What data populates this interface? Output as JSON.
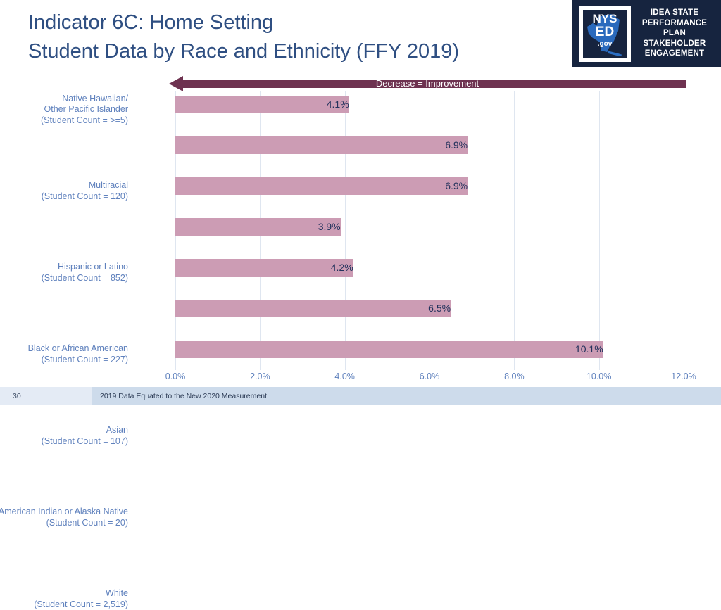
{
  "logo": {
    "badge_text": "NYS\nED\n.gov",
    "nys_line1": "NYS",
    "nys_line2": "ED",
    "nys_line3": ".gov",
    "caption": "IDEA STATE\nPERFORMANCE\nPLAN\nSTAKEHOLDER\nENGAGEMENT",
    "background_color": "#16243f"
  },
  "header": {
    "title": "Indicator 6C: Home Setting\nStudent Data by Race and Ethnicity (FFY 2019)",
    "title_color": "#2f4f82"
  },
  "banner": {
    "label": "Decrease = Improvement",
    "color": "#6e3250"
  },
  "footer": {
    "slide_number": "30",
    "note": "2019 Data Equated to the New 2020 Measurement"
  },
  "chart_data": {
    "type": "bar",
    "orientation": "horizontal",
    "title": "Indicator 6C: Home Setting Student Data by Race and Ethnicity (FFY 2019)",
    "xlabel": "",
    "ylabel": "",
    "xlim": [
      0,
      12
    ],
    "grid": true,
    "legend": "none",
    "bar_color": "#cc9cb4",
    "value_label_color": "#23325c",
    "category_label_color": "#5f81bd",
    "tick_labels": [
      "0.0%",
      "2.0%",
      "4.0%",
      "6.0%",
      "8.0%",
      "10.0%",
      "12.0%"
    ],
    "tick_values": [
      0,
      2,
      4,
      6,
      8,
      10,
      12
    ],
    "categories": [
      "Native Hawaiian/\nOther Pacific Islander\n(Student Count = >=5)",
      "Multiracial\n(Student Count = 120)",
      "Hispanic or Latino\n(Student Count = 852)",
      "Black or African American\n(Student Count = 227)",
      "Asian\n(Student Count = 107)",
      "American Indian or Alaska Native\n(Student Count = 20)",
      "White\n(Student Count = 2,519)"
    ],
    "values": [
      4.1,
      6.9,
      6.9,
      3.9,
      4.2,
      6.5,
      10.1
    ],
    "value_labels": [
      "4.1%",
      "6.9%",
      "6.9%",
      "3.9%",
      "4.2%",
      "6.5%",
      "10.1%"
    ],
    "annotation": "Decrease = Improvement"
  }
}
